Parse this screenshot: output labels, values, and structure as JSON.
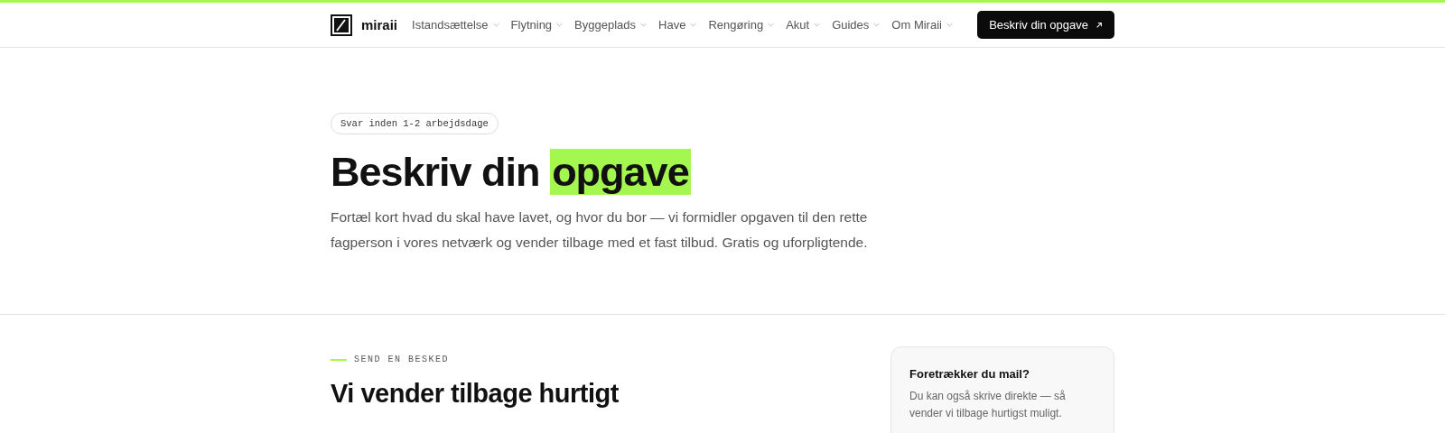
{
  "header": {
    "logo": "miraii",
    "nav": [
      {
        "label": "Istandsættelse",
        "has_menu": true
      },
      {
        "label": "Flytning",
        "has_menu": true
      },
      {
        "label": "Byggeplads",
        "has_menu": true
      },
      {
        "label": "Have",
        "has_menu": true
      },
      {
        "label": "Rengøring",
        "has_menu": true
      },
      {
        "label": "Akut",
        "has_menu": true
      },
      {
        "label": "Guides",
        "has_menu": true
      },
      {
        "label": "Om Miraii",
        "has_menu": true
      }
    ],
    "cta": "Beskriv din opgave"
  },
  "hero": {
    "badge": "Svar inden 1-2 arbejdsdage",
    "title": "Beskriv din",
    "title_highlight": "opgave",
    "lead": "Fortæl kort hvad du skal have lavet, og hvor du bor — vi formidler opgaven til den rette fagperson i vores netværk og vender tilbage med et fast tilbud. Gratis og uforpligtende."
  },
  "contact": {
    "eyebrow": "SEND EN BESKED",
    "heading": "Vi vender tilbage hurtigt",
    "aside": {
      "title": "Foretrækker du mail?",
      "text": "Du kan også skrive direkte — så vender vi tilbage hurtigst muligt."
    }
  }
}
